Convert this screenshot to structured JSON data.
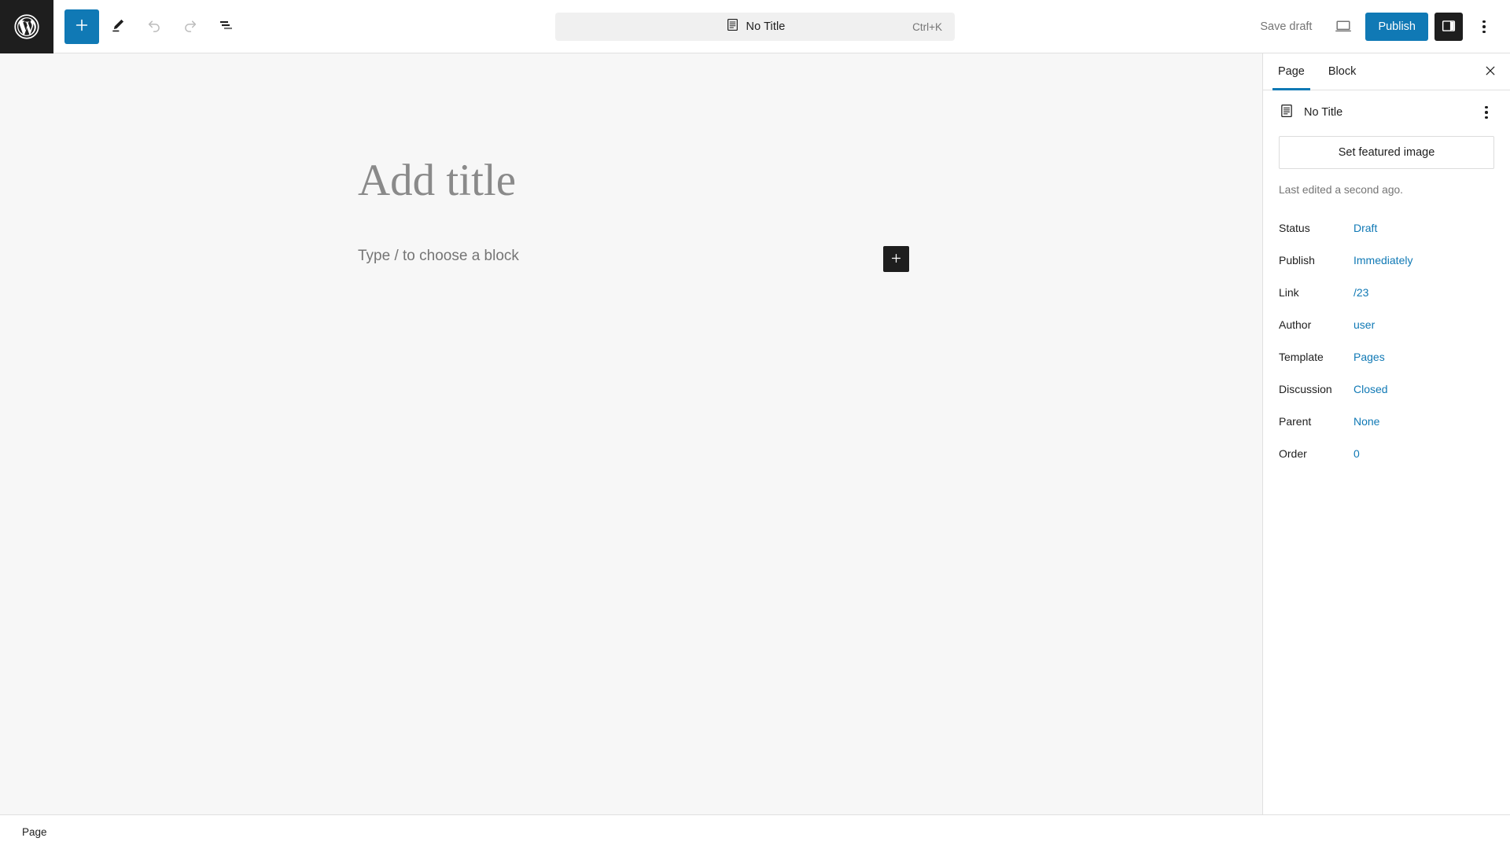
{
  "app": {
    "logo_icon": "wordpress-logo-icon"
  },
  "toolbar": {
    "add_block_label": "+",
    "add_block_icon": "plus-icon",
    "tools_icon": "pencil-icon",
    "undo_icon": "undo-arrow-icon",
    "redo_icon": "redo-arrow-icon",
    "list_view_icon": "document-overview-icon",
    "save_draft_label": "Save draft",
    "preview_icon": "desktop-preview-icon",
    "publish_label": "Publish",
    "sidebar_toggle_icon": "settings-panel-icon",
    "options_icon": "kebab-menu-icon"
  },
  "document_bar": {
    "icon": "page-document-icon",
    "title": "No Title",
    "shortcut": "Ctrl+K"
  },
  "canvas": {
    "title_placeholder": "Add title",
    "paragraph_placeholder": "Type / to choose a block",
    "inserter_icon": "plus-icon"
  },
  "sidebar": {
    "tabs": [
      {
        "label": "Page",
        "active": true
      },
      {
        "label": "Block",
        "active": false
      }
    ],
    "close_icon": "close-icon",
    "document": {
      "icon": "page-document-icon",
      "name": "No Title",
      "actions_icon": "kebab-menu-icon"
    },
    "featured_image_label": "Set featured image",
    "last_edited": "Last edited a second ago.",
    "meta": [
      {
        "label": "Status",
        "value": "Draft"
      },
      {
        "label": "Publish",
        "value": "Immediately"
      },
      {
        "label": "Link",
        "value": "/23"
      },
      {
        "label": "Author",
        "value": "user"
      },
      {
        "label": "Template",
        "value": "Pages"
      },
      {
        "label": "Discussion",
        "value": "Closed"
      },
      {
        "label": "Parent",
        "value": "None"
      },
      {
        "label": "Order",
        "value": "0"
      }
    ]
  },
  "statusbar": {
    "label": "Page"
  },
  "colors": {
    "accent": "#1079b5",
    "dark": "#1e1e1e",
    "canvas_bg": "#f7f7f7",
    "muted_text": "#757575"
  }
}
